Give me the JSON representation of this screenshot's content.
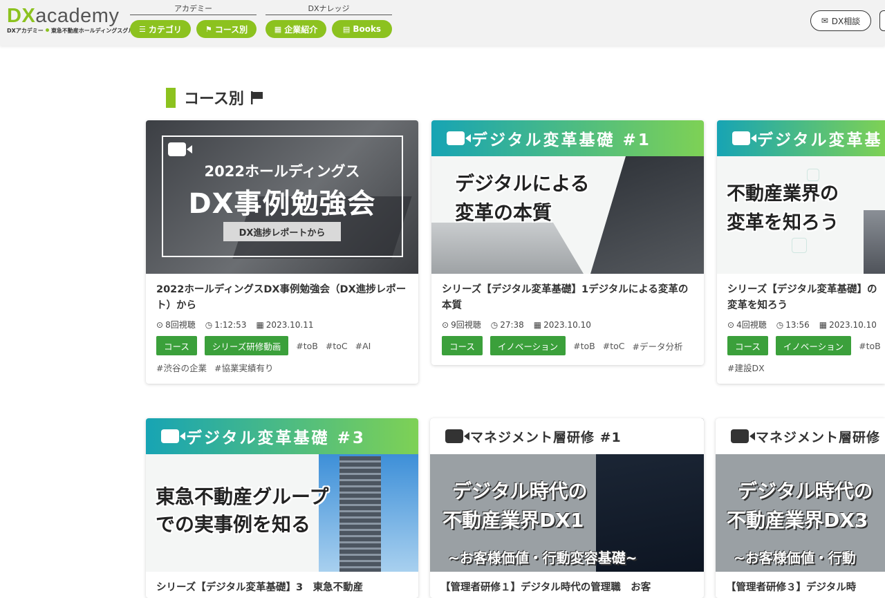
{
  "logo": {
    "brand_a": "DX",
    "brand_b": "academy",
    "sub_a": "DXアカデミー",
    "sub_b": "東急不動産ホールディングスグループ"
  },
  "nav": {
    "academy": {
      "title": "アカデミー",
      "items": [
        {
          "label": "カテゴリ",
          "icon": "list-icon"
        },
        {
          "label": "コース別",
          "icon": "flag-icon"
        }
      ]
    },
    "knowledge": {
      "title": "DXナレッジ",
      "items": [
        {
          "label": "企業紹介",
          "icon": "building-icon"
        },
        {
          "label": "Books",
          "icon": "book-icon"
        }
      ]
    }
  },
  "consult_label": "DX相談",
  "section_title": "コース別",
  "colors": {
    "accent": "#8cc21f",
    "tag": "#3ba03b"
  },
  "cards": [
    {
      "thumb": {
        "line1": "2022ホールディングス",
        "line2": "DX事例勉強会",
        "badge": "DX進捗レポートから"
      },
      "title": "2022ホールディングスDX事例勉強会（DX進捗レポート）から",
      "views": "8回視聴",
      "duration": "1:12:53",
      "date": "2023.10.11",
      "tags": [
        "コース",
        "シリーズ研修動画"
      ],
      "hashtags": [
        "#toB",
        "#toC",
        "#AI",
        "#渋谷の企業",
        "#協業実績有り"
      ]
    },
    {
      "thumb": {
        "banner": "デジタル変革基礎 #1",
        "line1": "デジタルによる",
        "line2": "変革の本質"
      },
      "title": "シリーズ【デジタル変革基礎】1デジタルによる変革の本質",
      "views": "9回視聴",
      "duration": "27:38",
      "date": "2023.10.10",
      "tags": [
        "コース",
        "イノベーション"
      ],
      "hashtags": [
        "#toB",
        "#toC",
        "#データ分析"
      ]
    },
    {
      "thumb": {
        "banner": "デジタル変革基",
        "line1": "不動産業界の",
        "line2": "変革を知ろう"
      },
      "title": "シリーズ【デジタル変革基礎】の変革を知ろう",
      "views": "4回視聴",
      "duration": "13:56",
      "date": "2023.10.10",
      "tags": [
        "コース",
        "イノベーション"
      ],
      "hashtags": [
        "#toB",
        "#建設DX"
      ]
    },
    {
      "thumb": {
        "banner": "デジタル変革基礎 #3",
        "line1": "東急不動産グループ",
        "line2": "での実事例を知る"
      },
      "title": "シリーズ【デジタル変革基礎】3　東急不動産"
    },
    {
      "thumb": {
        "banner": "マネジメント層研修 #1",
        "line1": "デジタル時代の",
        "line2": "不動産業界DX1",
        "line3": "~お客様価値・行動変容基礎~"
      },
      "title": "【管理者研修１】デジタル時代の管理職　お客"
    },
    {
      "thumb": {
        "banner": "マネジメント層研修",
        "line1": "デジタル時代の",
        "line2": "不動産業界DX3",
        "line3": "~お客様価値・行動"
      },
      "title": "【管理者研修３】デジタル時"
    }
  ]
}
